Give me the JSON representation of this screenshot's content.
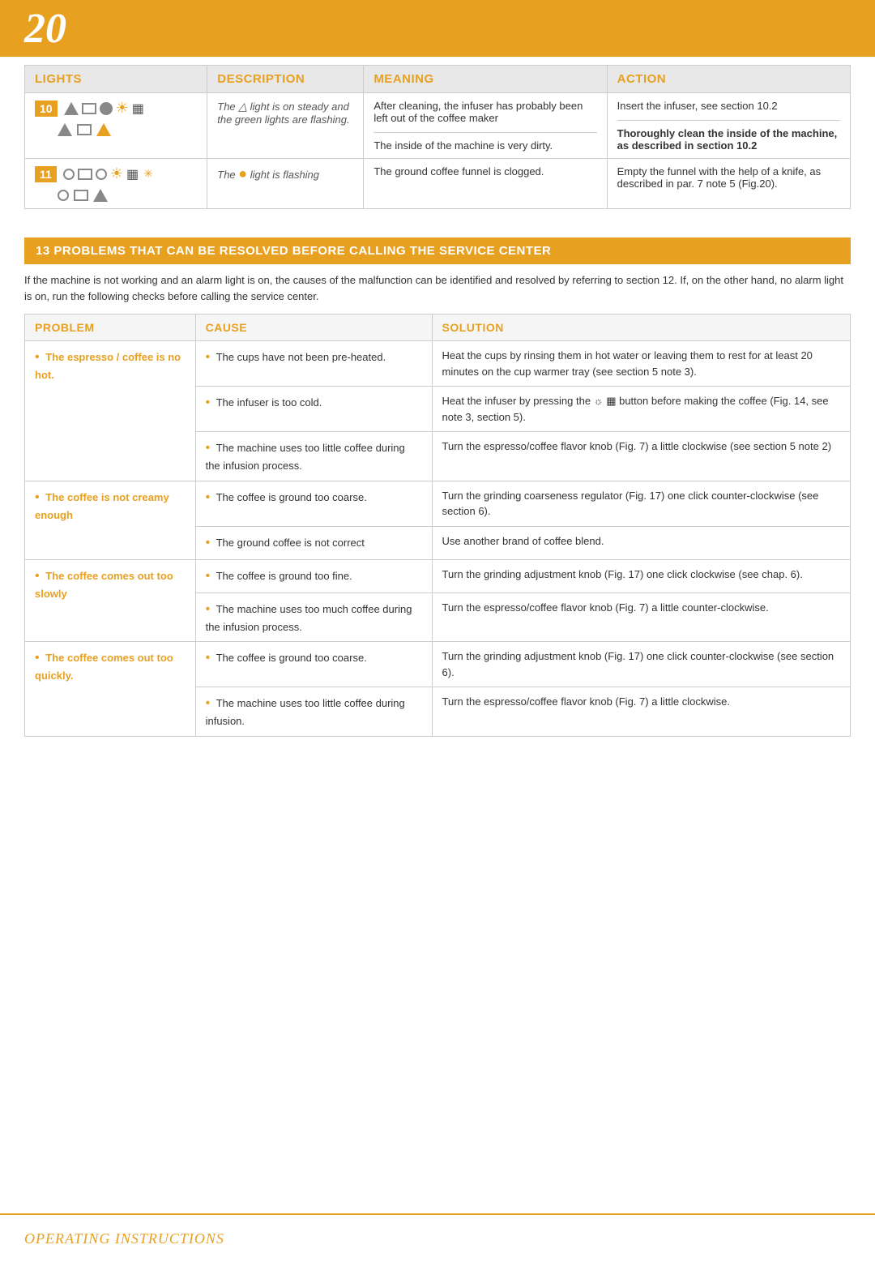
{
  "page": {
    "number": "20"
  },
  "lights_section": {
    "headers": {
      "lights": "LIGHTS",
      "description": "DESCRIPTION",
      "meaning": "MEANING",
      "action": "ACTION"
    },
    "rows": [
      {
        "row_num": "10",
        "description": "The △ light is on steady and the green lights are flashing.",
        "meanings": [
          "After cleaning, the infuser has probably been left out of the coffee maker",
          "The inside of the machine is very dirty."
        ],
        "actions": [
          "Insert the infuser, see section 10.2",
          "Thoroughly clean the inside of the machine, as described in section 10.2"
        ]
      },
      {
        "row_num": "11",
        "description": "The ● light is flashing",
        "meanings": [
          "The ground coffee funnel is clogged."
        ],
        "actions": [
          "Empty the funnel with the help of a knife, as described in par. 7 note 5 (Fig.20)."
        ]
      }
    ]
  },
  "section_13": {
    "title": "13 PROBLEMS THAT CAN BE RESOLVED BEFORE CALLING THE SERVICE CENTER",
    "intro": "If the machine is not working and an alarm light is on, the causes of the malfunction can be identified and resolved by referring to section 12. If, on the other hand, no alarm light is on, run the following checks before calling the service center.",
    "headers": {
      "problem": "PROBLEM",
      "cause": "CAUSE",
      "solution": "SOLUTION"
    },
    "problems": [
      {
        "problem": "The espresso / coffee is no hot.",
        "causes": [
          {
            "cause": "The cups have not been pre-heated.",
            "solution": "Heat the cups by rinsing them in hot water or leaving them to rest for at least 20 minutes on the cup warmer tray  (see section 5 note 3)."
          },
          {
            "cause": "The infuser is too cold.",
            "solution": "Heat the infuser by pressing the ☼ ▦ button before making the coffee (Fig. 14, see note 3, section 5)."
          },
          {
            "cause": "The machine uses too little coffee during the infusion process.",
            "solution": "Turn the espresso/coffee flavor knob (Fig. 7) a little clockwise (see section 5 note 2)"
          }
        ]
      },
      {
        "problem": "The coffee is not creamy enough",
        "causes": [
          {
            "cause": "The coffee is ground too coarse.",
            "solution": "Turn the grinding coarseness regulator (Fig. 17) one click counter-clockwise (see section 6)."
          },
          {
            "cause": "The ground coffee is not correct",
            "solution": "Use another brand of coffee blend."
          }
        ]
      },
      {
        "problem": "The coffee comes out too slowly",
        "causes": [
          {
            "cause": "The coffee is ground too fine.",
            "solution": "Turn the grinding adjustment knob (Fig. 17) one click clockwise (see chap. 6)."
          },
          {
            "cause": "The machine uses too much coffee during the infusion process.",
            "solution": "Turn the espresso/coffee flavor knob (Fig. 7) a little counter-clockwise."
          }
        ]
      },
      {
        "problem": "The coffee comes out too quickly.",
        "causes": [
          {
            "cause": "The coffee is ground too coarse.",
            "solution": "Turn the grinding adjustment knob (Fig. 17) one click counter-clockwise (see section 6)."
          },
          {
            "cause": "The machine uses too little coffee during infusion.",
            "solution": "Turn the espresso/coffee flavor knob (Fig. 7) a little clockwise."
          }
        ]
      }
    ]
  },
  "footer": {
    "text": "OPERATING INSTRUCTIONS"
  }
}
